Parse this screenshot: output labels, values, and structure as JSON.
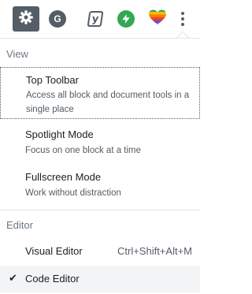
{
  "toolbar": {
    "settings_icon": "gear-icon",
    "g_avatar_letter": "G",
    "yoast_letter": "y",
    "bolt_icon": "lightning-bolt-icon",
    "rainbow_icon": "rainbow-heart-icon",
    "more_icon": "vertical-ellipsis-icon"
  },
  "menu": {
    "view_label": "View",
    "top_toolbar": {
      "title": "Top Toolbar",
      "description": "Access all block and document tools in a single place"
    },
    "spotlight": {
      "title": "Spotlight Mode",
      "description": "Focus on one block at a time"
    },
    "fullscreen": {
      "title": "Fullscreen Mode",
      "description": "Work without distraction"
    },
    "editor_label": "Editor",
    "visual_editor": {
      "title": "Visual Editor",
      "shortcut": "Ctrl+Shift+Alt+M"
    },
    "code_editor": {
      "title": "Code Editor",
      "check": "✔"
    }
  },
  "colors": {
    "accent": "#555d66",
    "bolt_green": "#34a853",
    "separator": "#e2e4e7",
    "selected_bg": "#f3f4f5"
  }
}
